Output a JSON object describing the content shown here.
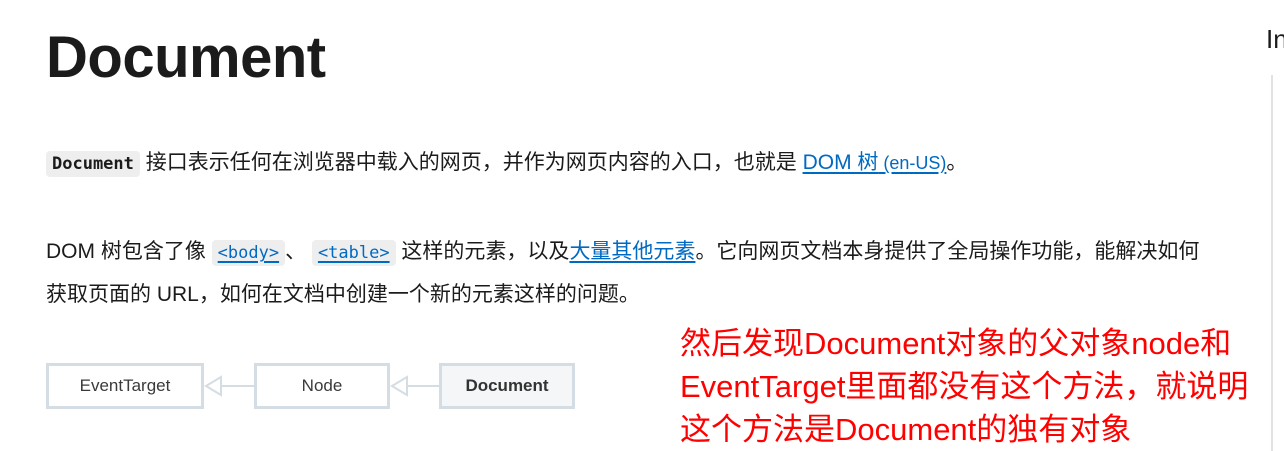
{
  "page_title": "Document",
  "side_truncated_text": "In",
  "intro": {
    "code_token": "Document",
    "text_before_link": " 接口表示任何在浏览器中载入的网页，并作为网页内容的入口，也就是 ",
    "link_text": "DOM 树",
    "link_locale": " (en-US)",
    "text_after_link": "。"
  },
  "description": {
    "lead": "DOM 树包含了像 ",
    "code_body": "<body>",
    "separator": "、 ",
    "code_table": "<table>",
    "mid_text": " 这样的元素，以及",
    "link_text": "大量其他元素",
    "tail_text": "。它向网页文档本身提供了全局操作功能，能解决如何获取页面的 URL，如何在文档中创建一个新的元素这样的问题。"
  },
  "inheritance_diagram": {
    "nodes": [
      "EventTarget",
      "Node",
      "Document"
    ],
    "current": "Document"
  },
  "annotation": {
    "lines": [
      "然后发现Document对象的父对象node和",
      "EventTarget里面都没有这个方法，就说明",
      "这个方法是Document的独有对象"
    ],
    "color": "#ff0000"
  },
  "colors": {
    "link": "#0069c2",
    "code_bg": "#eeeeee",
    "diagram_border": "#d3dde3",
    "text": "#1b1b1b"
  }
}
